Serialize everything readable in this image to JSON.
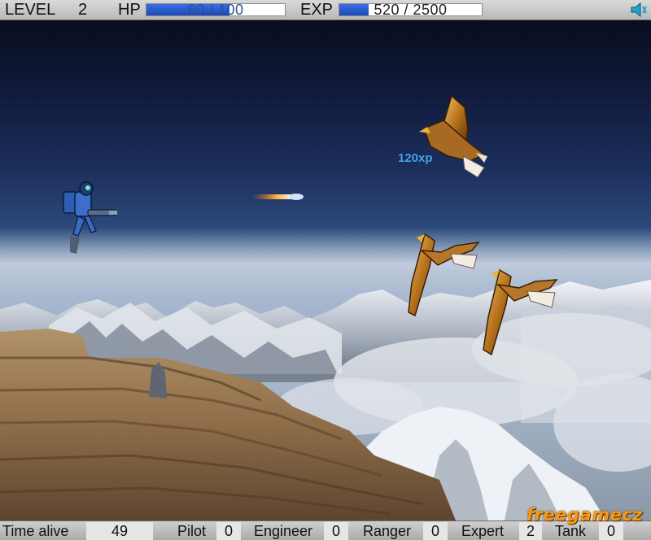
{
  "hud": {
    "level_label": "LEVEL",
    "level_value": "2",
    "hp_label": "HP",
    "hp_text": "60 / 100",
    "hp_fraction": 0.6,
    "exp_label": "EXP",
    "exp_text": "520 / 2500",
    "exp_fraction": 0.208,
    "sound_icon": "speaker-icon"
  },
  "stats": {
    "time_alive_label": "Time alive",
    "time_alive_value": "49",
    "pilot_label": "Pilot",
    "pilot_value": "0",
    "engineer_label": "Engineer",
    "engineer_value": "0",
    "ranger_label": "Ranger",
    "ranger_value": "0",
    "expert_label": "Expert",
    "expert_value": "2",
    "tank_label": "Tank",
    "tank_value": "0"
  },
  "scene": {
    "xp_popup": "120xp",
    "brand": "freegamecz"
  },
  "colors": {
    "hud_bg": "#c8c8c8",
    "bar_fill": "#2a5ad0",
    "xp_text": "#4aa0e8",
    "brand": "#f29a1c"
  }
}
